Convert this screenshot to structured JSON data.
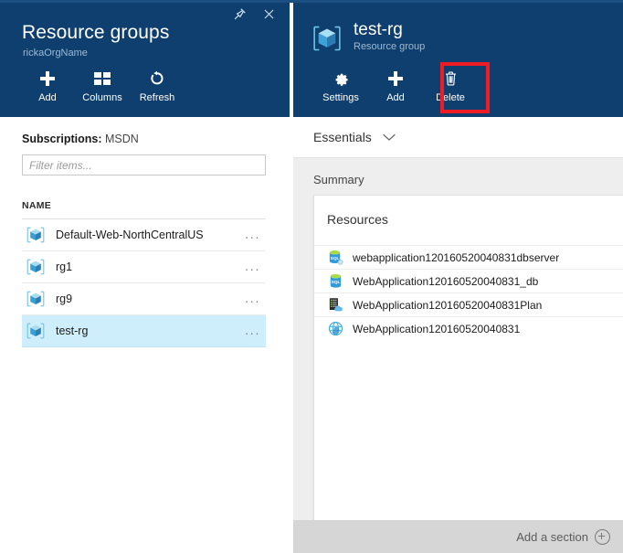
{
  "left_blade": {
    "title": "Resource groups",
    "subtitle": "rickaOrgName",
    "pin_icon": "pin-icon",
    "close_icon": "close-icon",
    "toolbar": [
      {
        "label": "Add",
        "icon": "plus-icon"
      },
      {
        "label": "Columns",
        "icon": "columns-icon"
      },
      {
        "label": "Refresh",
        "icon": "refresh-icon"
      }
    ],
    "subscriptions_label": "Subscriptions:",
    "subscriptions_value": "MSDN",
    "filter_placeholder": "Filter items...",
    "filter_value": "",
    "column_header": "NAME",
    "rows": [
      {
        "name": "Default-Web-NorthCentralUS",
        "icon": "resource-group-cube-icon",
        "selected": false,
        "more": "..."
      },
      {
        "name": "rg1",
        "icon": "resource-group-cube-icon",
        "selected": false,
        "more": "..."
      },
      {
        "name": "rg9",
        "icon": "resource-group-cube-icon",
        "selected": false,
        "more": "..."
      },
      {
        "name": "test-rg",
        "icon": "resource-group-cube-icon",
        "selected": true,
        "more": "..."
      }
    ]
  },
  "right_blade": {
    "title": "test-rg",
    "subtitle": "Resource group",
    "icon": "resource-group-cube-icon",
    "toolbar": [
      {
        "label": "Settings",
        "icon": "gear-icon"
      },
      {
        "label": "Add",
        "icon": "plus-icon"
      },
      {
        "label": "Delete",
        "icon": "trash-icon",
        "highlighted": true
      }
    ],
    "essentials_label": "Essentials",
    "essentials_chevron": "chevron-down-icon",
    "summary_label": "Summary",
    "card_title": "Resources",
    "resources": [
      {
        "name": "webapplication120160520040831dbserver",
        "icon": "sql-server-icon"
      },
      {
        "name": "WebApplication120160520040831_db",
        "icon": "sql-database-icon"
      },
      {
        "name": "WebApplication120160520040831Plan",
        "icon": "app-service-plan-icon"
      },
      {
        "name": "WebApplication120160520040831",
        "icon": "web-app-icon"
      }
    ],
    "add_section_label": "Add a section",
    "add_section_icon": "plus-circle-icon"
  },
  "colors": {
    "header_blue": "#0f3f6e",
    "highlight_red": "#ee1c25",
    "selected_row": "#cfeefb",
    "panel_grey": "#eeeeee",
    "footer_grey": "#d6d6d6"
  }
}
